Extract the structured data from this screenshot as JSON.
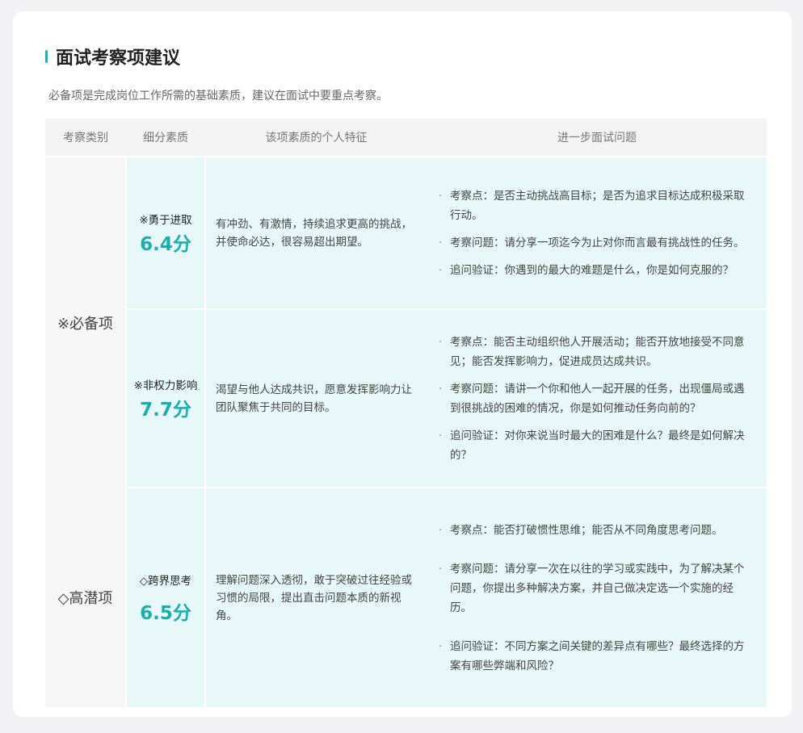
{
  "section": {
    "title": "面试考察项建议",
    "subtitle": "必备项是完成岗位工作所需的基础素质，建议在面试中要重点考察。"
  },
  "table": {
    "headers": [
      "考察类别",
      "细分素质",
      "该项素质的个人特征",
      "进一步面试问题"
    ],
    "categories": {
      "required": "※必备项",
      "potential": "◇高潜项"
    },
    "rows": [
      {
        "quality": "※勇于进取",
        "score": "6.4分",
        "feature": "有冲劲、有激情，持续追求更高的挑战，并使命必达，很容易超出期望。",
        "questions": [
          "考察点：是否主动挑战高目标；是否为追求目标达成积极采取行动。",
          "考察问题：请分享一项迄今为止对你而言最有挑战性的任务。",
          "追问验证：你遇到的最大的难题是什么，你是如何克服的？"
        ]
      },
      {
        "quality": "※非权力影响",
        "score": "7.7分",
        "feature": "渴望与他人达成共识，愿意发挥影响力让团队聚焦于共同的目标。",
        "questions": [
          "考察点：能否主动组织他人开展活动；能否开放地接受不同意见；能否发挥影响力，促进成员达成共识。",
          "考察问题：请讲一个你和他人一起开展的任务，出现僵局或遇到很挑战的困难的情况，你是如何推动任务向前的？",
          "追问验证：对你来说当时最大的困难是什么？最终是如何解决的？"
        ]
      },
      {
        "quality": "◇跨界思考",
        "score": "6.5分",
        "feature": "理解问题深入透彻，敢于突破过往经验或习惯的局限，提出直击问题本质的新视角。",
        "questions": [
          "考察点：能否打破惯性思维；能否从不同角度思考问题。",
          "考察问题：请分享一次在以往的学习或实践中，为了解决某个问题，你提出多种解决方案，并自己做决定选一个实施的经历。",
          "追问验证：不同方案之间关键的差异点有哪些？最终选择的方案有哪些弊端和风险？"
        ]
      }
    ]
  },
  "colors": {
    "accent": "#17b1ac",
    "row_bg": "#e8f8f8",
    "header_bg": "#f3f3f3"
  }
}
